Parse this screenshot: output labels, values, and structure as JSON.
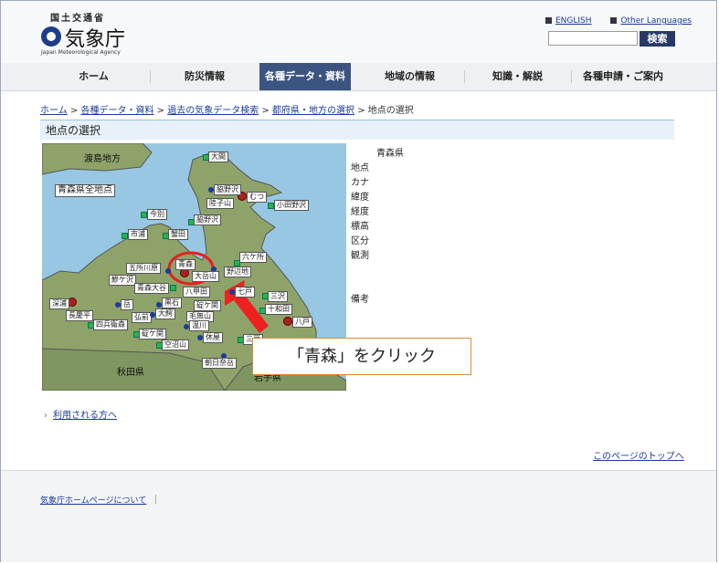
{
  "header": {
    "ministry": "国土交通省",
    "agency_name": "気象庁",
    "agency_en": "Japan Meteorological Agency",
    "lang_english": "ENGLISH",
    "lang_other": "Other Languages",
    "search_button": "検索",
    "search_placeholder": ""
  },
  "nav": {
    "items": [
      {
        "label": "ホーム"
      },
      {
        "label": "防災情報"
      },
      {
        "label": "各種データ・資料"
      },
      {
        "label": "地域の情報"
      },
      {
        "label": "知識・解説"
      },
      {
        "label": "各種申請・ご案内"
      }
    ],
    "active_index": 2
  },
  "breadcrumb": {
    "items": [
      "ホーム",
      "各種データ・資料",
      "過去の気象データ検索",
      "都府県・地方の選択"
    ],
    "current": "地点の選択",
    "separator": ">"
  },
  "page_title": "地点の選択",
  "map": {
    "all_points_label": "青森県全地点",
    "region_labels": [
      "渡島地方",
      "秋田県",
      "岩手県"
    ],
    "stations": [
      "大間",
      "むつ",
      "今別",
      "脇野沢",
      "陸子山",
      "小田野沢",
      "脇野沢",
      "蟹田",
      "市浦",
      "六ケ所",
      "五所川原",
      "青森",
      "野辺地",
      "鰺ケ沢",
      "大岳山",
      "青森大谷",
      "八甲田",
      "七戸",
      "三沢",
      "深浦",
      "岳",
      "黒石",
      "碇ケ関",
      "十和田",
      "長慶平",
      "弘前",
      "大鰐",
      "毛無山",
      "八戸",
      "四兵衛森",
      "温川",
      "碇ケ関",
      "休屋",
      "空沼山",
      "朝日奈岳",
      "三戸"
    ]
  },
  "station_info": {
    "prefecture": "青森県",
    "labels": [
      "地点",
      "カナ",
      "緯度",
      "経度",
      "標高",
      "区分",
      "観測",
      "備考"
    ]
  },
  "callout": "「青森」をクリック",
  "users_link": "利用される方へ",
  "to_top": "このページのトップへ",
  "footer": {
    "home_link": "気象庁ホームページについて"
  }
}
